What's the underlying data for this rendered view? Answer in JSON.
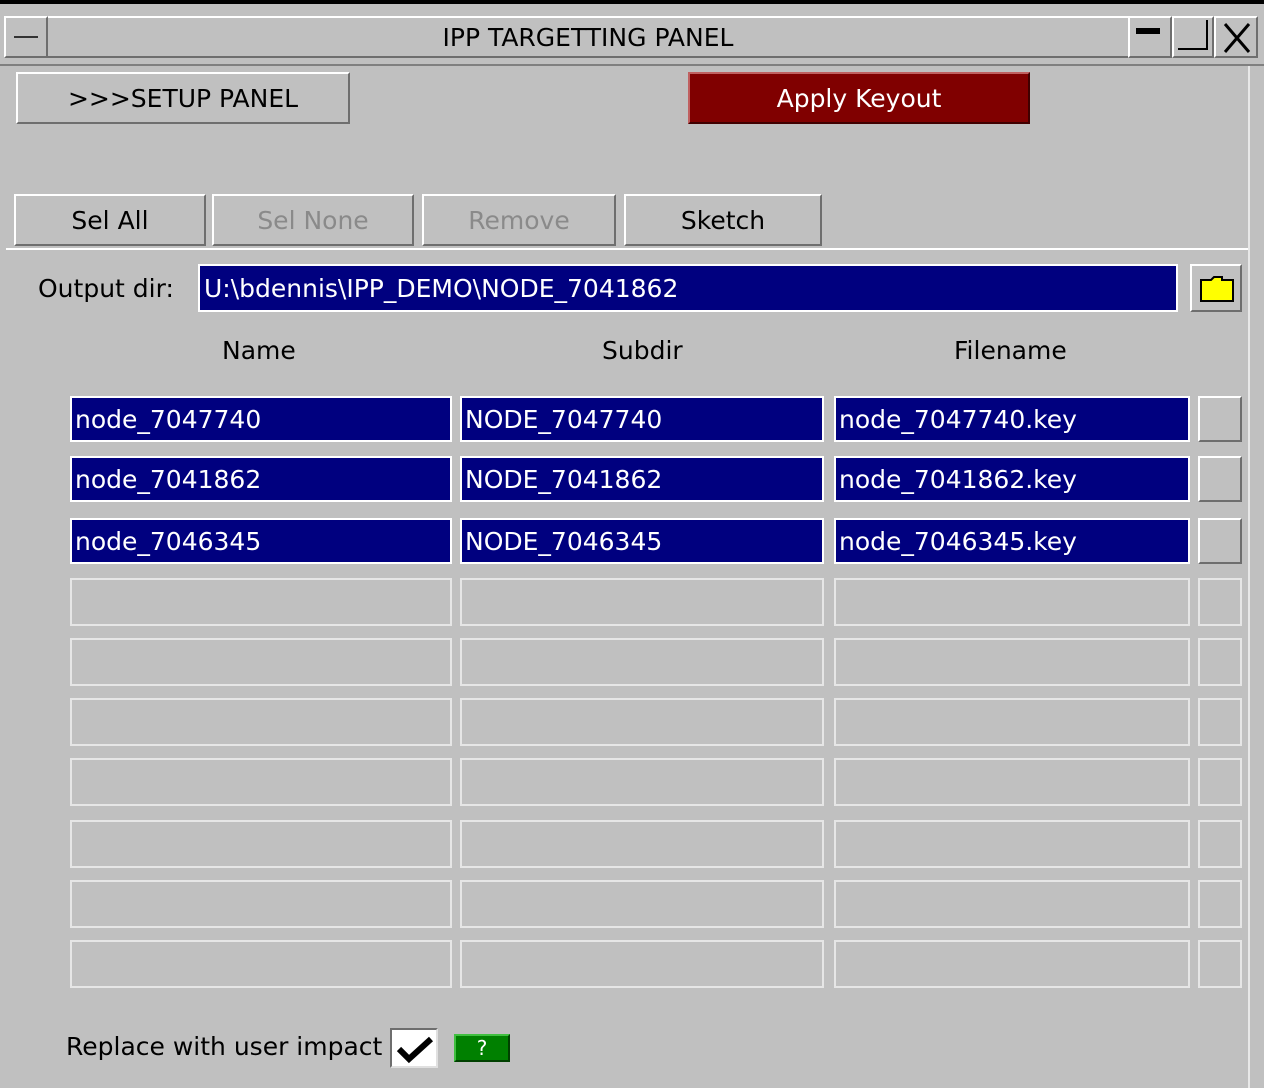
{
  "window": {
    "title": "IPP TARGETTING PANEL",
    "controls": {
      "menu_icon": "system-menu-icon",
      "minimize_icon": "minimize-icon",
      "maximize_icon": "maximize-icon",
      "close_icon": "close-icon"
    }
  },
  "toolbar": {
    "setup_label": ">>>SETUP PANEL",
    "apply_label": "Apply Keyout",
    "apply_color": "#800000"
  },
  "actions": {
    "sel_all": "Sel All",
    "sel_none": "Sel None",
    "remove": "Remove",
    "sketch": "Sketch"
  },
  "output": {
    "label": "Output dir:",
    "value": "U:\\bdennis\\IPP_DEMO\\NODE_7041862",
    "folder_icon": "folder-icon"
  },
  "table": {
    "headers": {
      "name": "Name",
      "subdir": "Subdir",
      "filename": "Filename"
    },
    "rows": [
      {
        "name": "node_7047740",
        "subdir": "NODE_7047740",
        "filename": "node_7047740.key"
      },
      {
        "name": "node_7041862",
        "subdir": "NODE_7041862",
        "filename": "node_7041862.key"
      },
      {
        "name": "node_7046345",
        "subdir": "NODE_7046345",
        "filename": "node_7046345.key"
      }
    ],
    "selected_color": "#00007f"
  },
  "footer": {
    "replace_label": "Replace with user impact",
    "replace_checked": true,
    "help_label": "?",
    "help_color": "#008000"
  }
}
